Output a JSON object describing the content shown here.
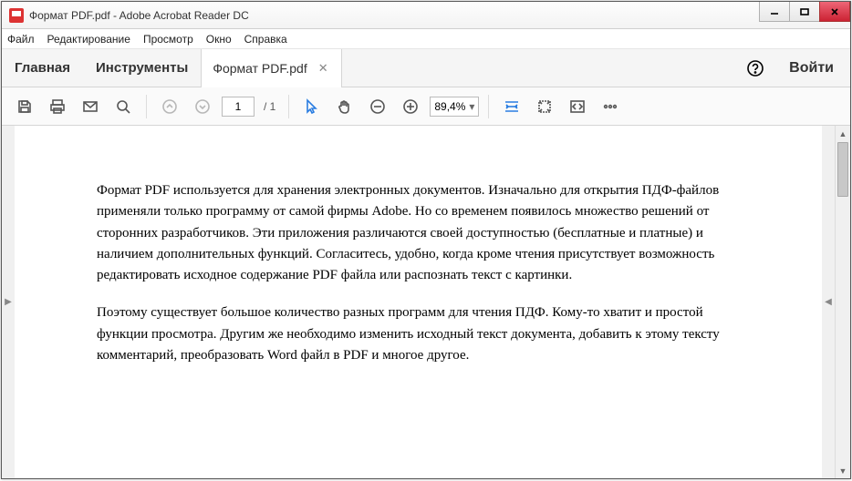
{
  "window": {
    "title": "Формат PDF.pdf - Adobe Acrobat Reader DC"
  },
  "menu": {
    "file": "Файл",
    "edit": "Редактирование",
    "view": "Просмотр",
    "window": "Окно",
    "help": "Справка"
  },
  "tabs": {
    "home": "Главная",
    "tools": "Инструменты",
    "doc": "Формат PDF.pdf",
    "signin": "Войти"
  },
  "toolbar": {
    "page_current": "1",
    "page_total": "/ 1",
    "zoom": "89,4%"
  },
  "document": {
    "p1": "Формат PDF используется для хранения электронных документов. Изначально для открытия ПДФ-файлов применяли только программу от самой фирмы Adobe. Но со временем появилось множество решений от сторонних разработчиков. Эти приложения различаются своей доступностью (бесплатные и платные) и наличием дополнительных функций. Согласитесь, удобно, когда кроме чтения присутствует возможность редактировать исходное содержание PDF файла или распознать текст с картинки.",
    "p2": "Поэтому существует большое количество разных программ для чтения ПДФ. Кому-то хватит и простой функции просмотра. Другим же необходимо изменить исходный текст документа, добавить к этому тексту комментарий, преобразовать Word файл в PDF и многое другое."
  }
}
